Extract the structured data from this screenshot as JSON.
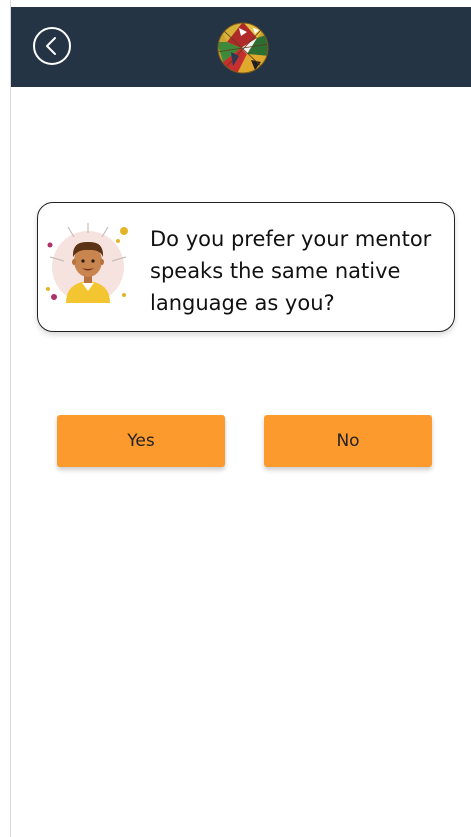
{
  "header": {
    "back_icon": "chevron-left-circle-icon",
    "logo_icon": "globe-logo-icon",
    "background": "#243444"
  },
  "question": {
    "text": "Do you prefer your mentor speaks the same native language as you?",
    "avatar_icon": "mentor-avatar-icon"
  },
  "answers": {
    "yes_label": "Yes",
    "no_label": "No",
    "button_color": "#fd9a2d"
  }
}
